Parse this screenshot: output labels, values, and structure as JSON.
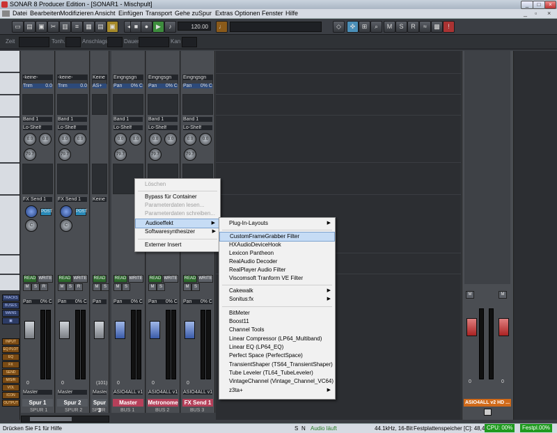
{
  "window": {
    "title": "SONAR 8 Producer Edition - [SONAR1 - Mischpult]"
  },
  "menu": [
    "Datei",
    "Bearbeiten",
    "Modifizieren",
    "Ansicht",
    "Einfügen",
    "Transport",
    "Gehe zu",
    "Spur",
    "Extras",
    "Optionen",
    "Fenster",
    "Hilfe"
  ],
  "toolbar": {
    "tempo": "120.00"
  },
  "event_bar": {
    "fields": [
      "Zeit",
      "Tonh.",
      "Anschlagst.",
      "Dauer",
      "Kan"
    ]
  },
  "left_rail": [
    "TRACKS",
    "BUSES",
    "MAINS",
    "",
    "INPUT",
    "EQ PLOT",
    "EQ",
    "FX",
    "SEND",
    "M/S/R",
    "VOL",
    "ICON",
    "OUTPUT"
  ],
  "strips": [
    {
      "top": "-keine-",
      "trim": "Trim",
      "trim_val": "0.0",
      "band": "Band 1",
      "shelf": "Lo-Shelf",
      "k1": "0.0",
      "k2": "0.0",
      "k3": "79.7",
      "fx": "FX Send 1",
      "pan": "Pan",
      "pan_val": "0% C",
      "out": "Master",
      "name": "Spur 1",
      "foot": "SPUR 1",
      "vol": "0"
    },
    {
      "top": "-keine-",
      "trim": "Trim",
      "trim_val": "0.0",
      "band": "Band 1",
      "shelf": "Lo-Shelf",
      "k1": "0.0",
      "k2": "0.0",
      "k3": "79.7",
      "fx": "FX Send 1",
      "pan": "Pan",
      "pan_val": "0% C",
      "out": "Master",
      "name": "Spur 2",
      "foot": "SPUR 2",
      "vol": "0"
    },
    {
      "top": "Keine",
      "trim": "AS+",
      "trim_val": "",
      "band": "",
      "shelf": "",
      "k1": "",
      "k2": "",
      "k3": "",
      "fx": "Keine",
      "pan": "Pan",
      "pan_val": "",
      "out": "Master",
      "name": "Spur 3",
      "foot": "SPUR",
      "vol": "(101)"
    },
    {
      "top": "Eingngsgn",
      "trim": "Pan",
      "trim_val": "0% C",
      "band": "Band 1",
      "shelf": "Lo-Shelf",
      "k1": "0.0",
      "k2": "0.0",
      "k3": "79.7",
      "fx": "",
      "pan": "Pan",
      "pan_val": "0% C",
      "out": "ASIO4ALL v1",
      "name": "Master",
      "foot": "BUS 1",
      "vol": "0"
    },
    {
      "top": "Eingngsgn",
      "trim": "Pan",
      "trim_val": "0% C",
      "band": "Band 1",
      "shelf": "Lo-Shelf",
      "k1": "0.0",
      "k2": "0.0",
      "k3": "79.7",
      "fx": "",
      "pan": "Pan",
      "pan_val": "0% C",
      "out": "ASIO4ALL v1",
      "name": "Metronome",
      "foot": "BUS 2",
      "vol": "0"
    },
    {
      "top": "Eingngsgn",
      "trim": "Pan",
      "trim_val": "0% C",
      "band": "Band 1",
      "shelf": "Lo-Shelf",
      "k1": "0.0",
      "k2": "0.0",
      "k3": "79.7",
      "fx": "",
      "pan": "Pan",
      "pan_val": "0% C",
      "out": "ASIO4ALL v1",
      "name": "FX Send 1",
      "foot": "BUS 3",
      "vol": "0"
    }
  ],
  "master_strip": {
    "out": "ASIO4ALL v2 HD ...",
    "vol_l": "0",
    "vol_r": "0"
  },
  "meter_scale": [
    "-3",
    "-6",
    "-9",
    "-12",
    "-15",
    "-18",
    "-21",
    "-24",
    "-27",
    "-30",
    "-33",
    "-36"
  ],
  "buttons": {
    "read": "READ",
    "write": "WRITE",
    "m": "M",
    "s": "S",
    "r": "R"
  },
  "context_menu": {
    "items": [
      "Löschen",
      "Bypass für Container",
      "Parameterdaten lesen...",
      "Parameterdaten schreiben...",
      "Audioeffekt",
      "Softwaresynthesizer",
      "Externer Insert"
    ]
  },
  "submenu": {
    "items": [
      "Plug-In-Layouts",
      "CustomFrameGrabber Filter",
      "HXAudioDeviceHook",
      "Lexicon Pantheon",
      "RealAudio Decoder",
      "RealPlayer Audio Filter",
      "Viscomsoft Tranform VE Filter",
      "Cakewalk",
      "Sonitus:fx",
      "BitMeter",
      "Boost11",
      "Channel Tools",
      "Linear Compressor (LP64_Multiband)",
      "Linear EQ (LP64_EQ)",
      "Perfect Space (PerfectSpace)",
      "TransientShaper (TS64_TransientShaper)",
      "Tube Leveler (TL64_TubeLeveler)",
      "VintageChannel (Vintage_Channel_VC64)",
      "z3ta+"
    ]
  },
  "status": {
    "left": "Drücken Sie F1 für Hilfe",
    "s": "S",
    "n": "N",
    "audio": "Audio läuft",
    "format": "44.1kHz, 16-Bit",
    "disk": "Festplattenspeicher [C]: 48,4G",
    "cpu": "CPU: 00%",
    "disk2": "Festpl.00%"
  }
}
